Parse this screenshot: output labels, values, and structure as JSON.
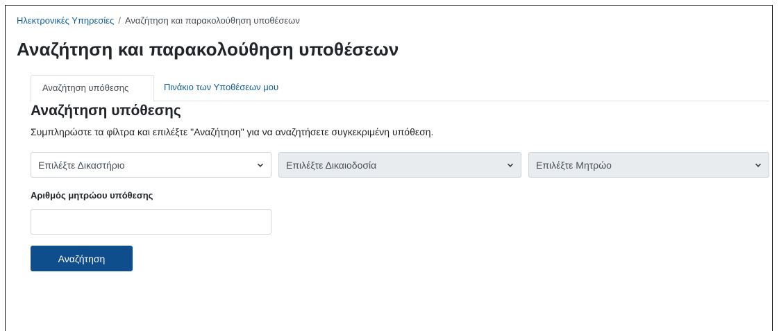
{
  "breadcrumb": {
    "home_label": "Ηλεκτρονικές Υπηρεσίες",
    "separator": "/",
    "current_label": "Αναζήτηση και παρακολούθηση υποθέσεων"
  },
  "page": {
    "title": "Αναζήτηση και παρακολούθηση υποθέσεων"
  },
  "tabs": [
    {
      "label": "Αναζήτηση υπόθεσης",
      "active": true
    },
    {
      "label": "Πινάκιο των Υποθέσεων μου",
      "active": false
    }
  ],
  "search_section": {
    "title": "Αναζήτηση υπόθεσης",
    "help_text": "Συμπληρώστε τα φίλτρα και επιλέξτε \"Αναζήτηση\" για να αναζητήσετε συγκεκριμένη υπόθεση."
  },
  "filters": {
    "court": {
      "selected": "Επιλέξτε Δικαστήριο",
      "disabled": false
    },
    "jurisdiction": {
      "selected": "Επιλέξτε Δικαιοδοσία",
      "disabled": true
    },
    "registry": {
      "selected": "Επιλέξτε Μητρώο",
      "disabled": true
    }
  },
  "case_number": {
    "label": "Αριθμός μητρώου υπόθεσης",
    "value": "",
    "placeholder": ""
  },
  "actions": {
    "search_label": "Αναζήτηση"
  },
  "colors": {
    "link": "#0f5d9c",
    "primary_button": "#0f4e8c",
    "disabled_field": "#e9ecef"
  }
}
